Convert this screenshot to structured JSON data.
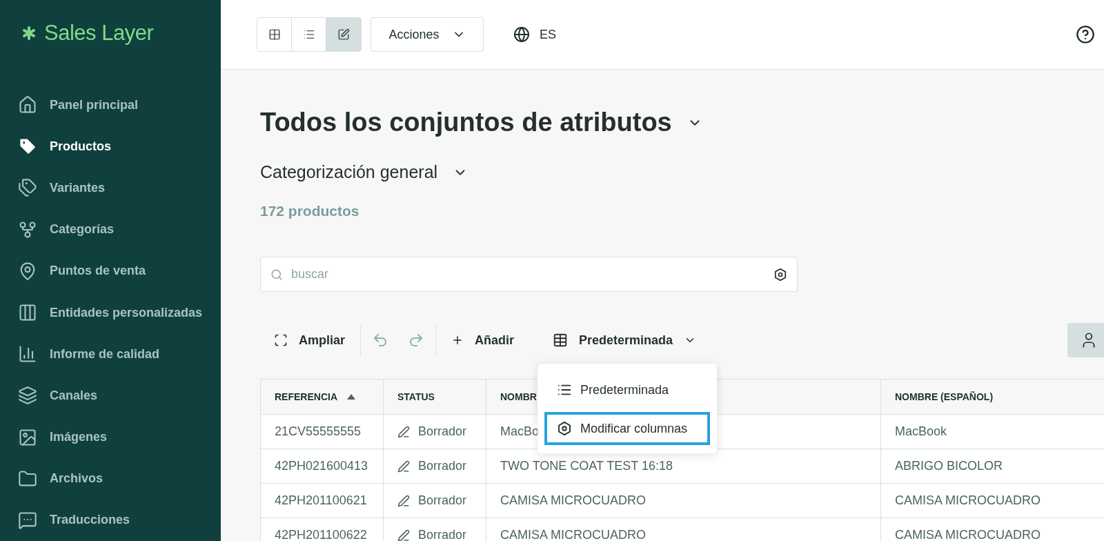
{
  "sidebar": {
    "logo": "Sales Layer",
    "items": [
      {
        "label": "Panel principal",
        "selected": false
      },
      {
        "label": "Productos",
        "selected": true
      },
      {
        "label": "Variantes",
        "selected": false
      },
      {
        "label": "Categorías",
        "selected": false
      },
      {
        "label": "Puntos de venta",
        "selected": false
      },
      {
        "label": "Entidades personalizadas",
        "selected": false
      },
      {
        "label": "Informe de calidad",
        "selected": false
      },
      {
        "label": "Canales",
        "selected": false
      },
      {
        "label": "Imágenes",
        "selected": false
      },
      {
        "label": "Archivos",
        "selected": false
      },
      {
        "label": "Traducciones",
        "selected": false
      }
    ]
  },
  "topbar": {
    "view_modes": [
      {
        "selected": false
      },
      {
        "selected": false
      },
      {
        "selected": true
      }
    ],
    "actions": "Acciones",
    "language": "ES"
  },
  "page": {
    "title": "Todos los conjuntos de atributos",
    "subtitle": "Categorización general",
    "count": "172 productos",
    "search": {
      "placeholder": "buscar"
    }
  },
  "table_toolbar": {
    "expand": "Ampliar",
    "undo_disabled": true,
    "redo_disabled": true,
    "add": "Añadir",
    "view": "Predeterminada"
  },
  "menu": {
    "items": [
      {
        "label": "Predeterminada",
        "selected": false
      },
      {
        "label": "Modificar columnas",
        "selected": true
      }
    ]
  },
  "table": {
    "columns": [
      {
        "label": "REFERENCIA",
        "sorted": true
      },
      {
        "label": "STATUS",
        "sorted": false
      },
      {
        "label": "NOMBR",
        "sorted": false
      },
      {
        "label": "NOMBRE (ESPAÑOL)",
        "sorted": false
      }
    ],
    "rows": [
      {
        "cells": [
          "21CV55555555",
          "Borrador",
          "MacBo",
          "MacBook"
        ]
      },
      {
        "cells": [
          "42PH021600413",
          "Borrador",
          "TWO TONE COAT TEST 16:18",
          "ABRIGO BICOLOR"
        ]
      },
      {
        "cells": [
          "42PH201100621",
          "Borrador",
          "CAMISA MICROCUADRO",
          "CAMISA MICROCUADRO"
        ]
      },
      {
        "cells": [
          "42PH201100622",
          "Borrador",
          "CAMISA MICROCUADRO",
          "CAMISA MICROCUADRO"
        ]
      }
    ]
  }
}
